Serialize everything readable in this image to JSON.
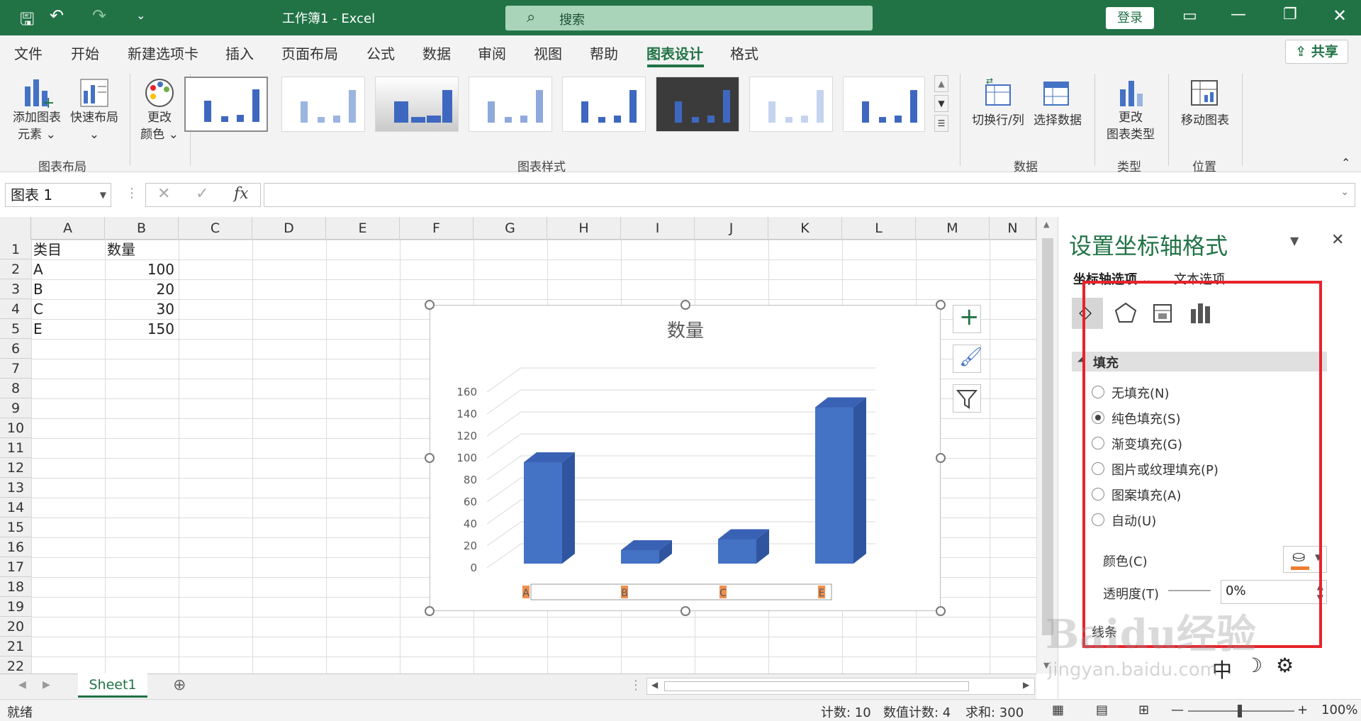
{
  "titlebar": {
    "title": "工作簿1 - Excel",
    "search_placeholder": "搜索",
    "login": "登录"
  },
  "menu": {
    "tabs": [
      "文件",
      "开始",
      "新建选项卡",
      "插入",
      "页面布局",
      "公式",
      "数据",
      "审阅",
      "视图",
      "帮助",
      "图表设计",
      "格式"
    ],
    "active_tab": "图表设计",
    "share": "共享"
  },
  "ribbon": {
    "add_element": "添加图表\n元素 ⌄",
    "quick_layout": "快速布局\n⌄",
    "change_colors": "更改\n颜色 ⌄",
    "group_layout": "图表布局",
    "group_styles": "图表样式",
    "switch_row_col": "切换行/列",
    "select_data": "选择数据",
    "group_data": "数据",
    "change_type": "更改\n图表类型",
    "group_type": "类型",
    "move_chart": "移动图表",
    "group_location": "位置"
  },
  "formula_bar": {
    "name_box": "图表 1",
    "fx": "fx"
  },
  "grid": {
    "columns": [
      "A",
      "B",
      "C",
      "D",
      "E",
      "F",
      "G",
      "H",
      "I",
      "J",
      "K",
      "L",
      "M",
      "N"
    ],
    "rows": [
      "1",
      "2",
      "3",
      "4",
      "5",
      "6",
      "7",
      "8",
      "9",
      "10",
      "11",
      "12",
      "13",
      "14",
      "15",
      "16",
      "17",
      "18",
      "19",
      "20",
      "21",
      "22"
    ],
    "header": [
      "类目",
      "数量"
    ],
    "data": [
      [
        "A",
        "100"
      ],
      [
        "B",
        "20"
      ],
      [
        "C",
        "30"
      ],
      [
        "E",
        "150"
      ]
    ]
  },
  "chart_data": {
    "type": "bar",
    "title": "数量",
    "categories": [
      "A",
      "B",
      "C",
      "E"
    ],
    "values": [
      100,
      20,
      30,
      150
    ],
    "ylim": [
      0,
      160
    ],
    "yticks": [
      "0",
      "20",
      "40",
      "60",
      "80",
      "100",
      "120",
      "140",
      "160"
    ],
    "bar_color": "#4472c4"
  },
  "pane": {
    "title": "设置坐标轴格式",
    "tab1": "坐标轴选项 ⌄",
    "tab2": "文本选项",
    "section": "填充",
    "options": [
      "无填充(N)",
      "纯色填充(S)",
      "渐变填充(G)",
      "图片或纹理填充(P)",
      "图案填充(A)",
      "自动(U)"
    ],
    "selected": "纯色填充(S)",
    "color_label": "颜色(C)",
    "transparency_label": "透明度(T)",
    "transparency_value": "0%",
    "next_section": "线条",
    "highlight_color": "#e8232b"
  },
  "sheets": {
    "active": "Sheet1"
  },
  "status": {
    "ready": "就绪",
    "count": "计数: 10",
    "numcount": "数值计数: 4",
    "sum": "求和: 300",
    "zoom": "100%"
  },
  "watermark": {
    "text": "Baidu经验",
    "sub": "jingyan.baidu.com"
  },
  "ime": {
    "mode": "中"
  }
}
